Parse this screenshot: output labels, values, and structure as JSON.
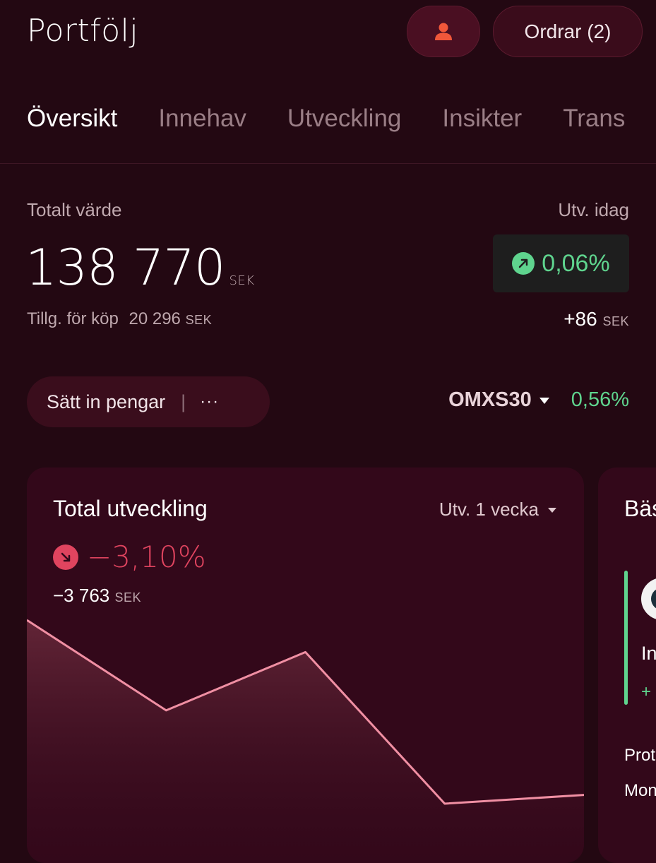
{
  "header": {
    "title": "Portfölj",
    "orders_label": "Ordrar (2)"
  },
  "tabs": [
    {
      "label": "Översikt",
      "active": true
    },
    {
      "label": "Innehav"
    },
    {
      "label": "Utveckling"
    },
    {
      "label": "Insikter"
    },
    {
      "label": "Trans"
    }
  ],
  "summary": {
    "total_label": "Totalt värde",
    "total_value": "138 770",
    "currency": "SEK",
    "available_label": "Tillg. för köp",
    "available_value": "20 296",
    "today_label": "Utv. idag",
    "today_percent": "0,06%",
    "today_amount": "+86"
  },
  "actions": {
    "deposit_label": "Sätt in pengar",
    "more_label": "···"
  },
  "index": {
    "name": "OMXS30",
    "change": "0,56%"
  },
  "performance_card": {
    "title": "Total utveckling",
    "period_label": "Utv. 1 vecka",
    "percent": "−3,10%",
    "amount": "−3 763",
    "currency": "SEK"
  },
  "next_card": {
    "title_partial": "Bäs",
    "line1": "In",
    "line2": "+",
    "line3": "Prot",
    "line4": "Mon"
  },
  "colors": {
    "background": "#230812",
    "card": "#33081a",
    "positive": "#5fd48e",
    "negative": "#e0445f",
    "line": "#f08fa3"
  },
  "chart_data": {
    "type": "area",
    "x": [
      1,
      2,
      3,
      4,
      5
    ],
    "values": [
      100,
      96.9,
      98.9,
      93.7,
      94.0
    ],
    "series": [
      {
        "values": [
          100,
          96.9,
          98.9,
          93.7,
          94.0
        ]
      }
    ],
    "title": "",
    "xlabel": "",
    "ylabel": "",
    "grid": false
  }
}
